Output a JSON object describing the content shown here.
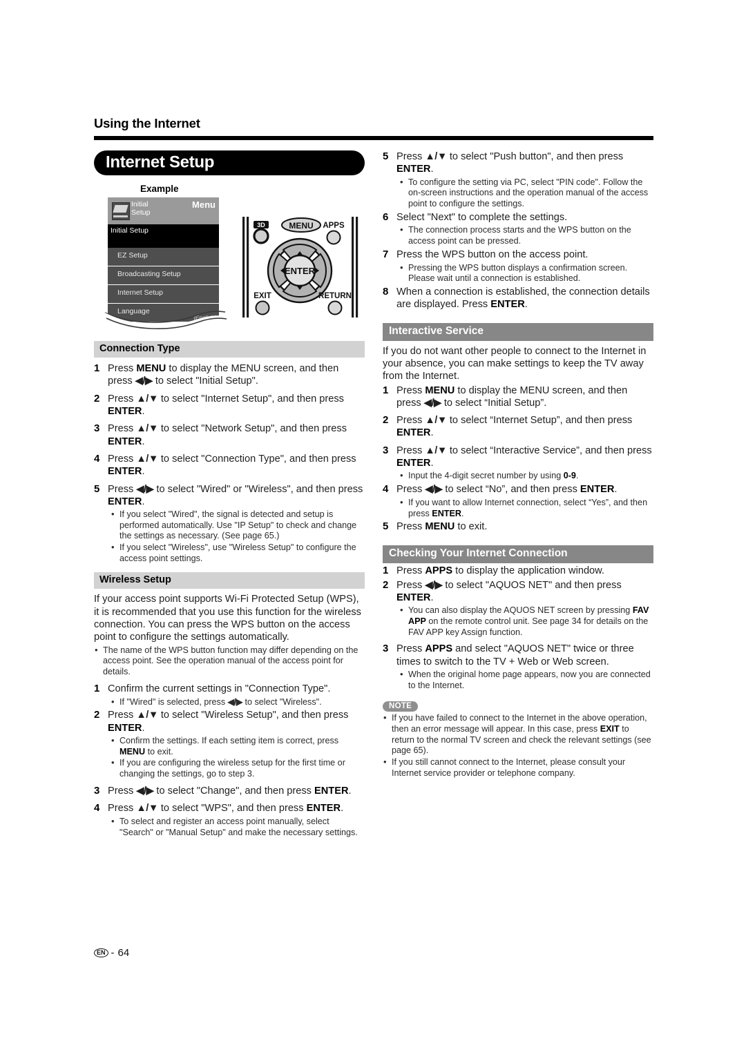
{
  "header": {
    "running_head": "Using the Internet"
  },
  "title_pill": {
    "label": "Internet Setup"
  },
  "example": {
    "label": "Example",
    "menu": {
      "icon": "initial-setup-icon",
      "header_title": "Initial\nSetup",
      "menu_word": "Menu",
      "selected_row": "Initial Setup",
      "rows": [
        {
          "label": "EZ Setup",
          "value": ""
        },
        {
          "label": "Broadcasting Setup",
          "value": ""
        },
        {
          "label": "Internet Setup",
          "value": ""
        },
        {
          "label": "Language",
          "value": "[English]"
        }
      ]
    },
    "remote": {
      "btn_3d": "3D",
      "btn_menu": "MENU",
      "btn_apps": "APPS",
      "btn_exit": "EXIT",
      "btn_return": "RETURN",
      "btn_enter": "ENTER"
    }
  },
  "left_column": {
    "connection_type": {
      "heading": "Connection Type",
      "steps": [
        {
          "num": "1",
          "html": "Press <b>MENU</b> to display the MENU screen, and then press <span class=\"arrows\">◀/▶</span> to select \"Initial Setup\"."
        },
        {
          "num": "2",
          "html": "Press <span class=\"arrows\">▲/▼</span> to select \"Internet Setup\", and then press <b>ENTER</b>."
        },
        {
          "num": "3",
          "html": "Press <span class=\"arrows\">▲/▼</span> to select \"Network Setup\", and then press <b>ENTER</b>."
        },
        {
          "num": "4",
          "html": "Press <span class=\"arrows\">▲/▼</span> to select \"Connection Type\", and then press <b>ENTER</b>."
        },
        {
          "num": "5",
          "html": "Press <span class=\"arrows\">◀/▶</span> to select \"Wired\" or \"Wireless\", and then press <b>ENTER</b>."
        }
      ],
      "step5_bullets": [
        "If you select \"Wired\", the signal is detected and setup is performed automatically. Use \"IP Setup\" to check and change the settings as necessary. (See page 65.)",
        "If you select \"Wireless\", use \"Wireless Setup\" to configure the access point settings."
      ]
    },
    "wireless_setup": {
      "heading": "Wireless Setup",
      "intro": "If your access point supports Wi-Fi Protected Setup (WPS), it is recommended that you use this function for the wireless connection. You can press the WPS button on the access point to configure the settings automatically.",
      "intro_bullets": [
        "The name of the WPS button function may differ depending on the access point. See the operation manual of the access point for details."
      ],
      "step1": {
        "num": "1",
        "html": "Confirm the current settings in \"Connection Type\"."
      },
      "step1_bullets_html": [
        "If \"Wired\" is selected, press <span class=\"arrows\">◀/▶</span> to select \"Wireless\"."
      ],
      "step2": {
        "num": "2",
        "html": "Press <span class=\"arrows\">▲/▼</span> to select \"Wireless Setup\", and then press <b>ENTER</b>."
      },
      "step2_bullets_html": [
        "Confirm the settings. If each setting item is correct, press <b>MENU</b> to exit.",
        "If you are configuring the wireless setup for the first time or changing the settings, go to step 3."
      ],
      "step3": {
        "num": "3",
        "html": "Press <span class=\"arrows\">◀/▶</span> to select \"Change\", and then press <b>ENTER</b>."
      },
      "step4": {
        "num": "4",
        "html": "Press <span class=\"arrows\">▲/▼</span> to select \"WPS\", and then press <b>ENTER</b>."
      },
      "step4_bullets": [
        "To select and register an access point manually, select \"Search\" or \"Manual Setup\" and make the necessary settings."
      ]
    }
  },
  "right_column": {
    "continued_steps": {
      "step5": {
        "num": "5",
        "html": "Press <span class=\"arrows\">▲/▼</span> to select \"Push button\", and then press <b>ENTER</b>."
      },
      "step5_bullets": [
        "To configure the setting via PC, select \"PIN code\". Follow the on-screen instructions and the operation manual of the access point to configure the settings."
      ],
      "step6": {
        "num": "6",
        "html": "Select \"Next\" to complete the settings."
      },
      "step6_bullets": [
        "The connection process starts and the WPS button on the access point can be pressed."
      ],
      "step7": {
        "num": "7",
        "html": "Press the WPS button on the access point."
      },
      "step7_bullets": [
        "Pressing the WPS button displays a confirmation screen. Please wait until a connection is established."
      ],
      "step8": {
        "num": "8",
        "html": "When a connection is established, the connection details are displayed. Press <b>ENTER</b>."
      }
    },
    "interactive_service": {
      "heading": "Interactive Service",
      "intro": "If you do not want other people to connect to the Internet in your absence, you can make settings to keep the TV away from the Internet.",
      "steps": [
        {
          "num": "1",
          "html": "Press <b>MENU</b> to display the MENU screen, and then press <span class=\"arrows\">◀/▶</span> to select “Initial Setup”."
        },
        {
          "num": "2",
          "html": "Press <span class=\"arrows\">▲/▼</span> to select “Internet Setup”, and then press <b>ENTER</b>."
        },
        {
          "num": "3",
          "html": "Press <span class=\"arrows\">▲/▼</span> to select “Interactive Service”, and then press <b>ENTER</b>."
        }
      ],
      "step3_bullets_html": [
        "Input the 4-digit secret number by using <b>0-9</b>."
      ],
      "step4": {
        "num": "4",
        "html": "Press <span class=\"arrows\">◀/▶</span> to select “No”, and then press <b>ENTER</b>."
      },
      "step4_bullets_html": [
        "If you want to allow Internet connection, select “Yes”, and then press <b>ENTER</b>."
      ],
      "step5": {
        "num": "5",
        "html": "Press <b>MENU</b> to exit."
      }
    },
    "checking_connection": {
      "heading": "Checking Your Internet Connection",
      "step1": {
        "num": "1",
        "html": "Press <b>APPS</b> to display the application window."
      },
      "step2": {
        "num": "2",
        "html": "Press <span class=\"arrows\">◀/▶</span> to select \"AQUOS NET\" and then press <b>ENTER</b>."
      },
      "step2_bullets_html": [
        "You can also display the AQUOS NET screen by pressing <b>FAV APP</b> on the remote control unit. See page 34 for details on the FAV APP key Assign function."
      ],
      "step3": {
        "num": "3",
        "html": "Press <b>APPS</b> and select \"AQUOS NET\" twice or three times to switch to the TV + Web or Web screen."
      },
      "step3_bullets": [
        "When the original home page appears, now you are connected to the Internet."
      ]
    },
    "note": {
      "badge": "NOTE",
      "bullets_html": [
        "If you have failed to connect to the Internet in the above operation, then an error message will appear. In this case, press <b>EXIT</b> to return to the normal TV screen and check the relevant settings (see page 65).",
        "If you still cannot connect to the Internet, please consult your Internet service provider or telephone company."
      ]
    }
  },
  "footer": {
    "lang_mark": "EN",
    "separator": "-",
    "page_number": "64"
  }
}
